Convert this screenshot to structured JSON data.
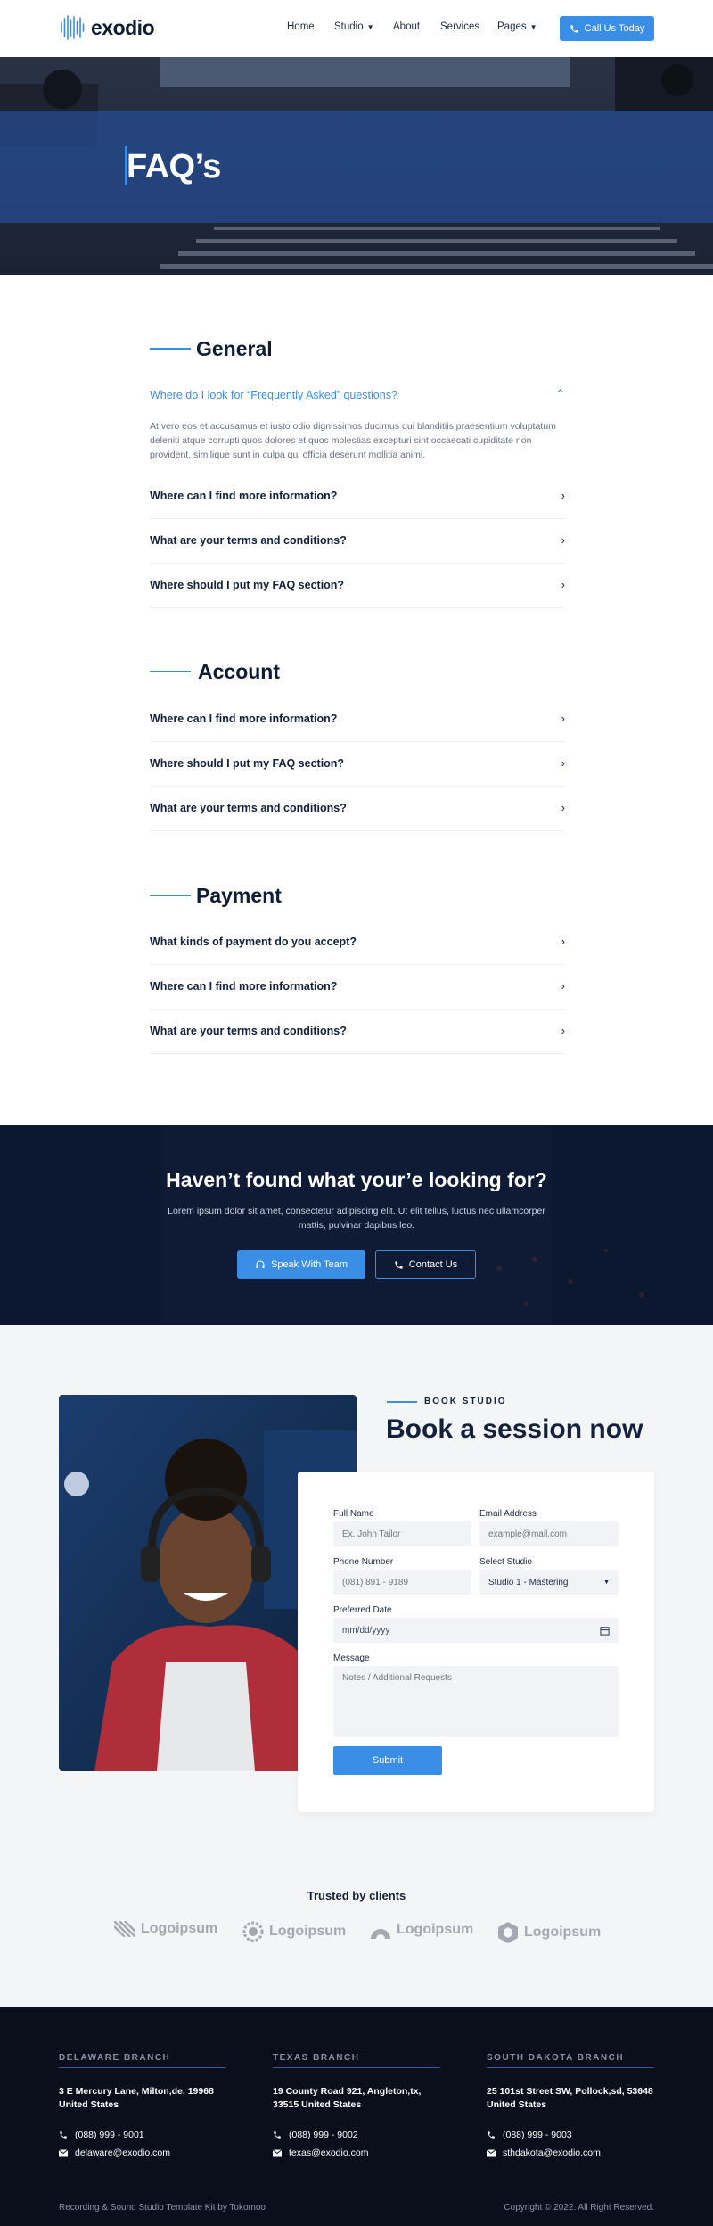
{
  "header": {
    "logo_text": "exodio",
    "nav": [
      {
        "label": "Home",
        "caret": false
      },
      {
        "label": "Studio",
        "caret": true
      },
      {
        "label": "About",
        "caret": false
      },
      {
        "label": "Services",
        "caret": false
      },
      {
        "label": "Pages",
        "caret": true
      }
    ],
    "cta_label": "Call Us Today"
  },
  "hero": {
    "title": "FAQ’s"
  },
  "faq": {
    "general": {
      "title": "General",
      "open_question": "Where do I look for “Frequently Asked” questions?",
      "answer": "At vero eos et accusamus et iusto odio dignissimos ducimus qui blanditiis praesentium voluptatum deleniti atque corrupti quos dolores et quos molestias excepturi sint occaecati cupiditate non provident, similique sunt in culpa qui officia deserunt mollitia animi.",
      "questions": [
        "Where can I find more information?",
        "What are your terms and conditions?",
        "Where should I put my FAQ section?"
      ]
    },
    "account": {
      "title": "Account",
      "questions": [
        "Where can I find more information?",
        "Where should I put my FAQ section?",
        "What are your terms and conditions?"
      ]
    },
    "payment": {
      "title": "Payment",
      "questions": [
        "What kinds of payment do you accept?",
        "Where can I find more information?",
        "What are your terms and conditions?"
      ]
    }
  },
  "cta": {
    "title": "Haven’t found what your’e looking for?",
    "text": "Lorem ipsum dolor sit amet, consectetur adipiscing elit. Ut elit tellus, luctus nec ullamcorper mattis, pulvinar dapibus leo.",
    "primary_label": "Speak With Team",
    "secondary_label": "Contact Us"
  },
  "booking": {
    "eyebrow": "BOOK STUDIO",
    "title": "Book a session now",
    "form": {
      "full_name_label": "Full Name",
      "full_name_placeholder": "Ex. John Tailor",
      "email_label": "Email Address",
      "email_placeholder": "example@mail.com",
      "phone_label": "Phone Number",
      "phone_placeholder": "(081) 891 - 9189",
      "studio_label": "Select Studio",
      "studio_value": "Studio 1 - Mastering",
      "date_label": "Preferred Date",
      "date_placeholder": "mm/dd/yyyy",
      "message_label": "Message",
      "message_placeholder": "Notes / Additional Requests",
      "submit_label": "Submit"
    }
  },
  "trusted": {
    "title": "Trusted by clients",
    "brands": [
      "Logoipsum",
      "Logoipsum",
      "Logoipsum",
      "Logoipsum"
    ]
  },
  "footer": {
    "branches": [
      {
        "name": "DELAWARE BRANCH",
        "address": "3 E Mercury Lane, Milton,de, 19968 United States",
        "phone": "(088) 999 - 9001",
        "email": "delaware@exodio.com"
      },
      {
        "name": "TEXAS BRANCH",
        "address": "19 County Road 921, Angleton,tx, 33515 United States",
        "phone": "(088) 999 - 9002",
        "email": "texas@exodio.com"
      },
      {
        "name": "SOUTH DAKOTA BRANCH",
        "address": "25 101st Street SW, Pollock,sd, 53648 United States",
        "phone": "(088) 999 - 9003",
        "email": "sthdakota@exodio.com"
      }
    ],
    "credit": "Recording & Sound Studio Template Kit by Tokomoo",
    "copyright": "Copyright © 2022. All Right Reserved."
  },
  "colors": {
    "accent": "#3a8ee6",
    "navy": "#13213d",
    "footer_bg": "#0b0f1c",
    "section_bg": "#f4f5f7"
  }
}
